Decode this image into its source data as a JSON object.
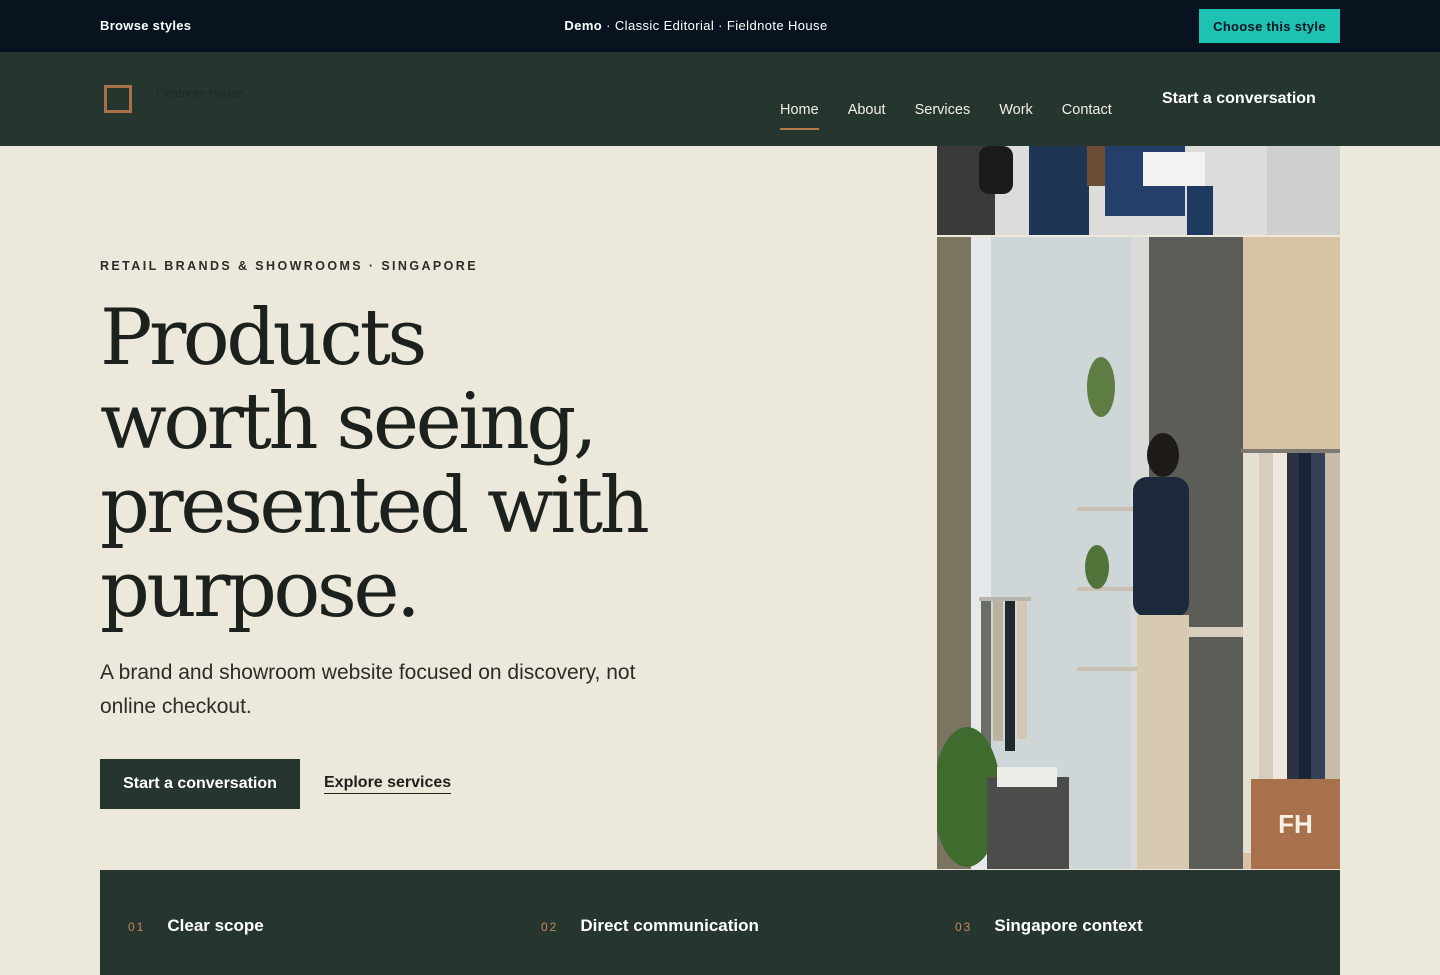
{
  "demo_bar": {
    "browse_label": "Browse styles",
    "crumb_bold": "Demo",
    "crumb_rest": " · Classic Editorial · Fieldnote House",
    "choose_label": "Choose this style",
    "accent": "#1ec2b3",
    "background": "#08131f"
  },
  "nav": {
    "brand": "Fieldnote House",
    "links": [
      {
        "label": "Home",
        "active": true
      },
      {
        "label": "About"
      },
      {
        "label": "Services"
      },
      {
        "label": "Work"
      },
      {
        "label": "Contact"
      }
    ],
    "cta": "Start a conversation",
    "background": "#26352d"
  },
  "hero": {
    "eyebrow": "RETAIL BRANDS & SHOWROOMS · SINGAPORE",
    "headline_lines": [
      "Products",
      "worth seeing,",
      "presented with",
      "purpose."
    ],
    "subline": "A brand and showroom website focused on discovery, not online checkout.",
    "primary_cta": "Start a conversation",
    "secondary_cta": "Explore services",
    "badge": "FH",
    "badge_color": "#a8714b"
  },
  "features": [
    {
      "num": "01",
      "label": "Clear scope"
    },
    {
      "num": "02",
      "label": "Direct communication"
    },
    {
      "num": "03",
      "label": "Singapore context"
    }
  ]
}
